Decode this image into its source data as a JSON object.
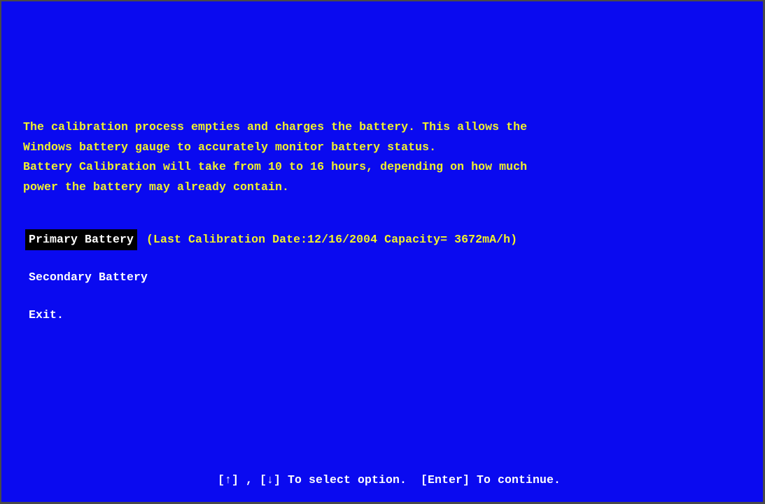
{
  "intro": {
    "lines": [
      "The calibration process empties and charges the battery. This allows the",
      "Windows battery gauge to accurately monitor battery status.",
      "Battery Calibration will take from 10 to 16 hours, depending on how much",
      "power the battery may already contain."
    ]
  },
  "menu": {
    "items": [
      {
        "label": "Primary Battery",
        "info": "(Last Calibration Date:12/16/2004 Capacity= 3672mA/h)",
        "selected": true
      },
      {
        "label": "Secondary Battery",
        "info": "",
        "selected": false
      },
      {
        "label": "Exit.",
        "info": "",
        "selected": false
      }
    ]
  },
  "footer": {
    "hint": "[↑] , [↓] To select option.  [Enter] To continue."
  },
  "colors": {
    "background": "#0a0af0",
    "text_yellow": "#f2f22a",
    "text_white": "#ffffff",
    "highlight": "#000000"
  }
}
